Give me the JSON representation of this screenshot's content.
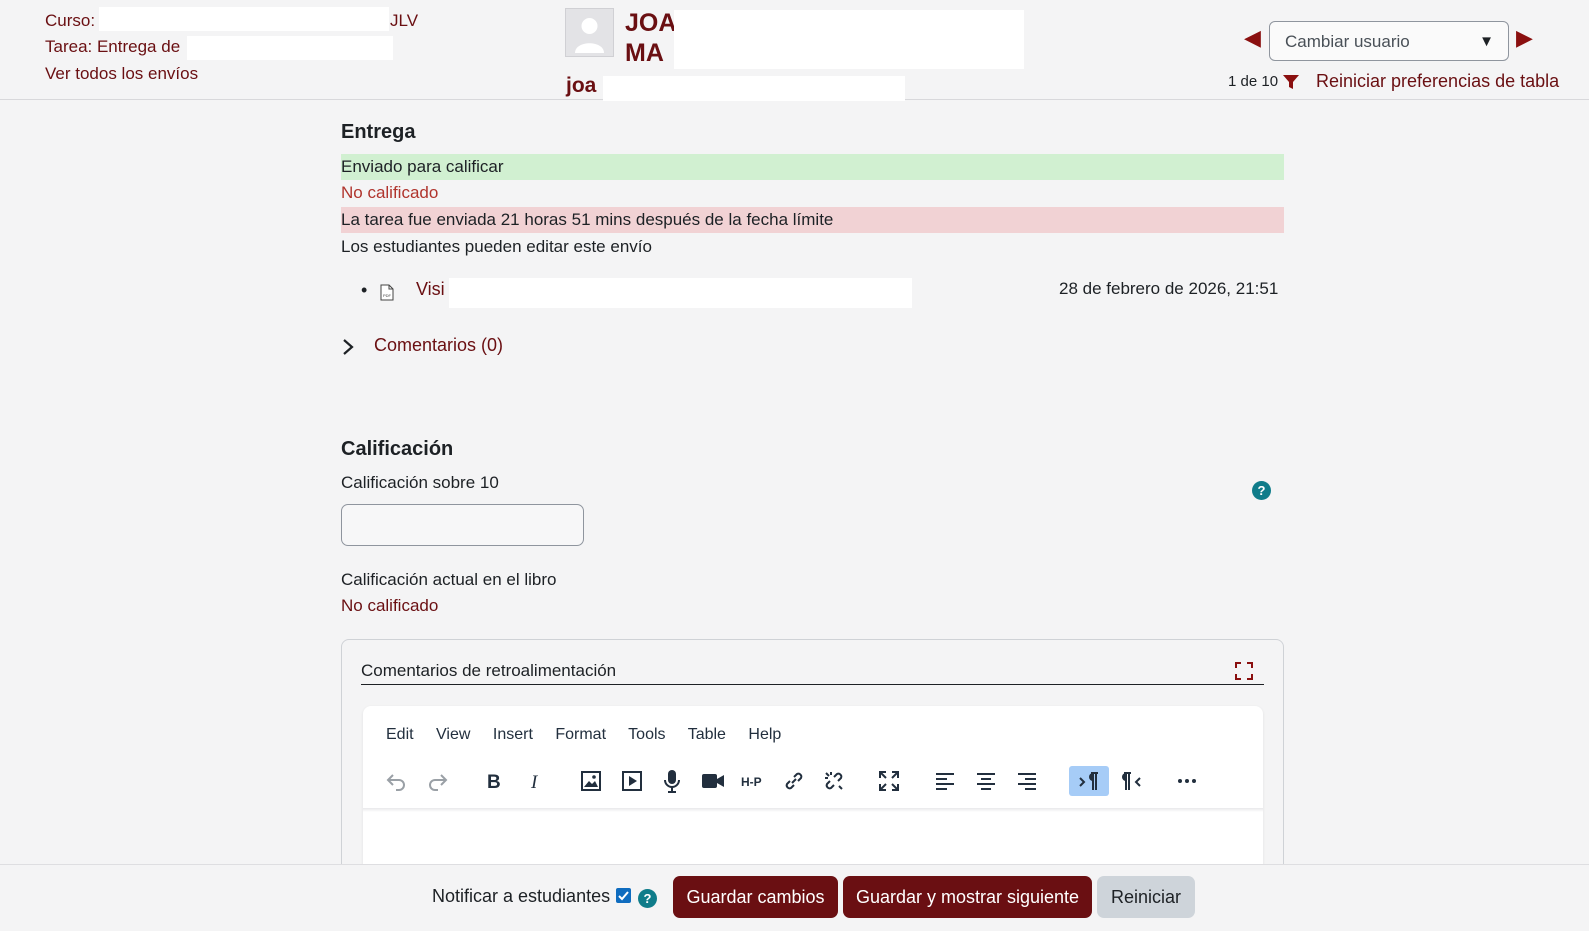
{
  "header": {
    "course_label": "Curso:",
    "course_suffix": "JLV",
    "assignment_label": "Tarea: Entrega de",
    "view_all_link": "Ver todos los envíos",
    "user_name_line1": "JOA",
    "user_name_line2": "MA",
    "user_login": "joa",
    "change_user_placeholder": "Cambiar usuario",
    "page_count": "1 de 10",
    "reset_prefs_link": "Reiniciar preferencias de tabla"
  },
  "submission": {
    "title": "Entrega",
    "status_submitted": "Enviado para calificar",
    "status_grading": "No calificado",
    "status_late": "La tarea fue enviada 21 horas 51 mins después de la fecha límite",
    "status_editable": "Los estudiantes pueden editar este envío",
    "file_name": "Visi",
    "file_date": "28 de febrero de 2026, 21:51",
    "comments_link": "Comentarios (0)"
  },
  "grading": {
    "title": "Calificación",
    "grade_label": "Calificación sobre 10",
    "grade_value": "",
    "gradebook_label": "Calificación actual en el libro",
    "gradebook_value": "No calificado",
    "help_glyph": "?"
  },
  "feedback": {
    "title": "Comentarios de retroalimentación",
    "menu": [
      "Edit",
      "View",
      "Insert",
      "Format",
      "Tools",
      "Table",
      "Help"
    ]
  },
  "footer": {
    "notify_label": "Notificar a estudiantes",
    "notify_checked": true,
    "save_label": "Guardar cambios",
    "save_next_label": "Guardar y mostrar siguiente",
    "reset_label": "Reiniciar"
  },
  "colors": {
    "brand": "#6a0f12",
    "success_bg": "#d1f0d1",
    "danger_bg": "#f1d2d4",
    "danger_text": "#b0342d",
    "help": "#0f7c8a"
  },
  "icons": [
    "user-avatar-icon",
    "prev-arrow-icon",
    "next-arrow-icon",
    "filter-icon",
    "pdf-file-icon",
    "chevron-right-icon",
    "help-icon",
    "fullscreen-icon",
    "undo-icon",
    "redo-icon",
    "bold-icon",
    "italic-icon",
    "image-icon",
    "media-icon",
    "audio-icon",
    "video-icon",
    "h5p-icon",
    "link-icon",
    "unlink-icon",
    "fullscreen-editor-icon",
    "align-left-icon",
    "align-center-icon",
    "align-right-icon",
    "ltr-icon",
    "rtl-icon",
    "more-icon",
    "checkbox-check-icon"
  ]
}
